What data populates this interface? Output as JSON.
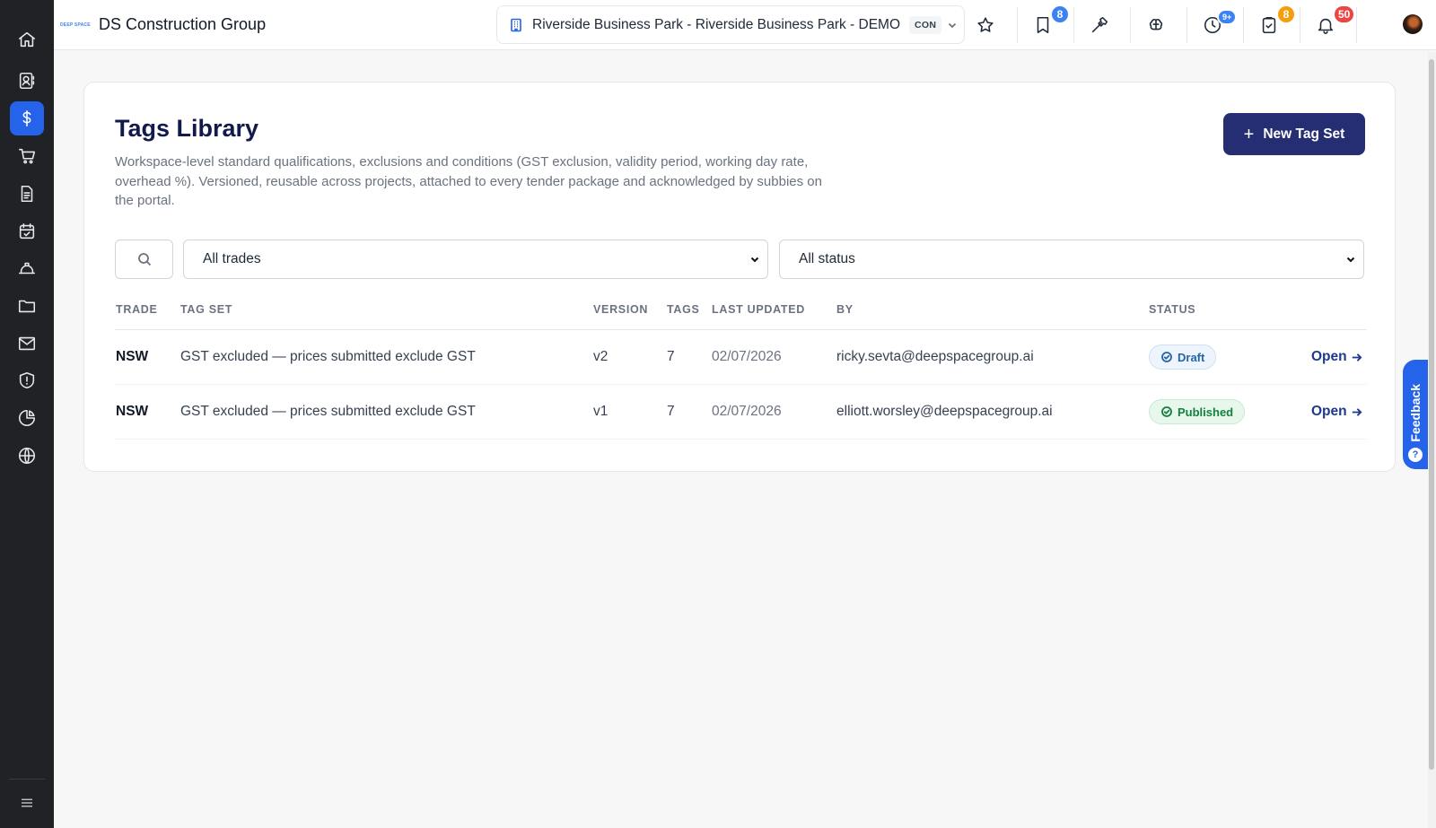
{
  "brand": {
    "logo_text": "DEEP SPACE",
    "name": "DS Construction Group"
  },
  "project": {
    "name": "Riverside Business Park - Riverside Business Park - DEMO",
    "code": "CON"
  },
  "topbar": {
    "bookmarks_badge": "8",
    "history_badge": "9+",
    "tasks_badge": "8",
    "notifications_badge": "50"
  },
  "page": {
    "title": "Tags Library",
    "description": "Workspace-level standard qualifications, exclusions and conditions (GST exclusion, validity period, working day rate, overhead %). Versioned, reusable across projects, attached to every tender package and acknowledged by subbies on the portal.",
    "new_button": "New Tag Set"
  },
  "filters": {
    "trades": "All trades",
    "status": "All status"
  },
  "table": {
    "headers": {
      "trade": "TRADE",
      "tag_set": "TAG SET",
      "version": "VERSION",
      "tags": "TAGS",
      "last_updated": "LAST UPDATED",
      "by": "BY",
      "status": "STATUS"
    },
    "rows": [
      {
        "trade": "NSW",
        "tag_set": "GST excluded — prices submitted exclude GST",
        "version": "v2",
        "tags": "7",
        "last_updated": "02/07/2026",
        "by": "ricky.sevta@deepspacegroup.ai",
        "status": "Draft",
        "action": "Open"
      },
      {
        "trade": "NSW",
        "tag_set": "GST excluded — prices submitted exclude GST",
        "version": "v1",
        "tags": "7",
        "last_updated": "02/07/2026",
        "by": "elliott.worsley@deepspacegroup.ai",
        "status": "Published",
        "action": "Open"
      }
    ]
  },
  "feedback": {
    "label": "Feedback",
    "icon": "?"
  },
  "colors": {
    "sidebar": "#212226",
    "accent": "#2563eb",
    "primary_button": "#262e73",
    "title": "#111a4a"
  }
}
